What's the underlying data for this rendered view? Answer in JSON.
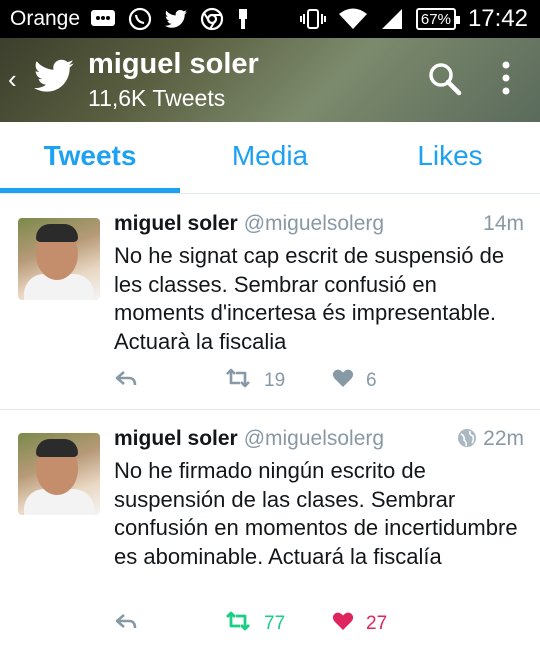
{
  "status_bar": {
    "carrier": "Orange",
    "battery": "67%",
    "time": "17:42"
  },
  "header": {
    "name": "miguel soler",
    "tweet_count": "11,6K Tweets"
  },
  "tabs": [
    {
      "label": "Tweets",
      "active": true
    },
    {
      "label": "Media",
      "active": false
    },
    {
      "label": "Likes",
      "active": false
    }
  ],
  "tweets": [
    {
      "name": "miguel soler",
      "handle": "@miguelsolerg",
      "time": "14m",
      "text": "No he signat cap escrit de suspensió de les classes. Sembrar confusió en moments d'incertesa és impresentable. Actuarà la fiscalia",
      "retweets": "19",
      "likes": "6",
      "retweeted": false,
      "liked": false
    },
    {
      "name": "miguel soler",
      "handle": "@miguelsolerg",
      "time": "22m",
      "text": "No he firmado ningún escrito de suspensión de las clases. Sembrar confusión en momentos de incertidumbre es abominable. Actuará la fiscalía",
      "retweets": "77",
      "likes": "27",
      "retweeted": true,
      "liked": true
    }
  ],
  "colors": {
    "accent": "#1da1f2",
    "retweet_active": "#19cf86",
    "like_active": "#e0245e",
    "muted": "#8899a6"
  }
}
